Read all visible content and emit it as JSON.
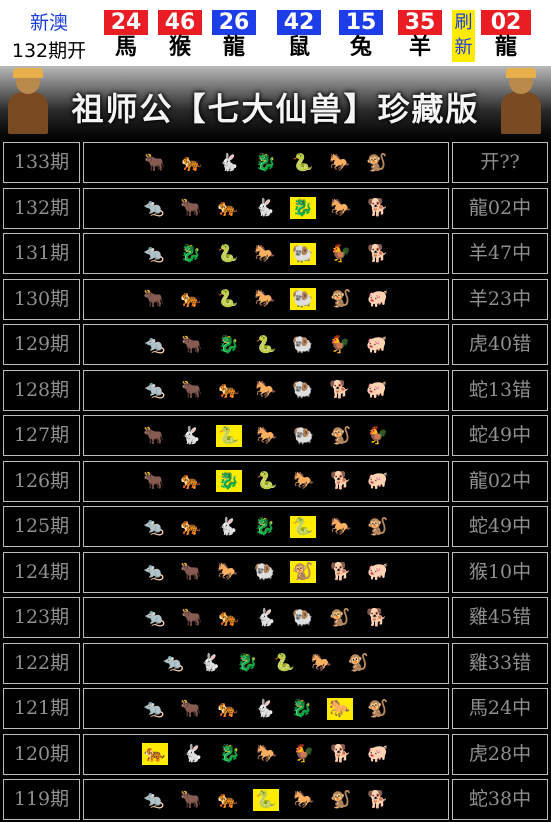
{
  "header": {
    "label_top": "新澳",
    "label_period": "132期开",
    "balls": [
      {
        "num": "24",
        "zodiac": "馬",
        "color": "red"
      },
      {
        "num": "46",
        "zodiac": "猴",
        "color": "red"
      },
      {
        "num": "26",
        "zodiac": "龍",
        "color": "blue"
      },
      {
        "num": "42",
        "zodiac": "鼠",
        "color": "blue"
      },
      {
        "num": "15",
        "zodiac": "兔",
        "color": "blue"
      },
      {
        "num": "35",
        "zodiac": "羊",
        "color": "red"
      }
    ],
    "refresh_label": "刷新",
    "special": {
      "num": "02",
      "zodiac": "龍",
      "color": "red"
    }
  },
  "banner": {
    "title": "祖师公【七大仙兽】珍藏版"
  },
  "icon_map": {
    "rat": "🐀",
    "ox": "🐂",
    "tiger": "🐅",
    "rabbit": "🐇",
    "dragon": "🐉",
    "snake": "🐍",
    "horse": "🐎",
    "goat": "🐏",
    "monkey": "🐒",
    "rooster": "🐓",
    "dog": "🐕",
    "pig": "🐖"
  },
  "rows": [
    {
      "period": "133期",
      "result": "开??",
      "animals": [
        "ox",
        "tiger",
        "rabbit",
        "dragon",
        "snake",
        "horse",
        "monkey"
      ],
      "highlight": -1
    },
    {
      "period": "132期",
      "result": "龍02中",
      "animals": [
        "rat",
        "ox",
        "tiger",
        "rabbit",
        "dragon",
        "horse",
        "dog"
      ],
      "highlight": 4
    },
    {
      "period": "131期",
      "result": "羊47中",
      "animals": [
        "rat",
        "dragon",
        "snake",
        "horse",
        "goat",
        "rooster",
        "dog"
      ],
      "highlight": 4
    },
    {
      "period": "130期",
      "result": "羊23中",
      "animals": [
        "ox",
        "tiger",
        "snake",
        "horse",
        "goat",
        "monkey",
        "pig"
      ],
      "highlight": 4
    },
    {
      "period": "129期",
      "result": "虎40错",
      "animals": [
        "rat",
        "ox",
        "dragon",
        "snake",
        "goat",
        "rooster",
        "pig"
      ],
      "highlight": -1
    },
    {
      "period": "128期",
      "result": "蛇13错",
      "animals": [
        "rat",
        "ox",
        "tiger",
        "horse",
        "goat",
        "dog",
        "pig"
      ],
      "highlight": -1
    },
    {
      "period": "127期",
      "result": "蛇49中",
      "animals": [
        "ox",
        "rabbit",
        "snake",
        "horse",
        "goat",
        "monkey",
        "rooster"
      ],
      "highlight": 2
    },
    {
      "period": "126期",
      "result": "龍02中",
      "animals": [
        "ox",
        "tiger",
        "dragon",
        "snake",
        "horse",
        "dog",
        "pig"
      ],
      "highlight": 2
    },
    {
      "period": "125期",
      "result": "蛇49中",
      "animals": [
        "rat",
        "tiger",
        "rabbit",
        "dragon",
        "snake",
        "horse",
        "monkey"
      ],
      "highlight": 4
    },
    {
      "period": "124期",
      "result": "猴10中",
      "animals": [
        "rat",
        "ox",
        "horse",
        "goat",
        "monkey",
        "dog",
        "pig"
      ],
      "highlight": 4
    },
    {
      "period": "123期",
      "result": "雞45错",
      "animals": [
        "rat",
        "ox",
        "tiger",
        "rabbit",
        "goat",
        "monkey",
        "dog"
      ],
      "highlight": -1
    },
    {
      "period": "122期",
      "result": "雞33错",
      "animals": [
        "rat",
        "rabbit",
        "dragon",
        "snake",
        "horse",
        "monkey"
      ],
      "highlight": -1
    },
    {
      "period": "121期",
      "result": "馬24中",
      "animals": [
        "rat",
        "ox",
        "tiger",
        "rabbit",
        "dragon",
        "horse",
        "monkey"
      ],
      "highlight": 5
    },
    {
      "period": "120期",
      "result": "虎28中",
      "animals": [
        "tiger",
        "rabbit",
        "dragon",
        "horse",
        "rooster",
        "dog",
        "pig"
      ],
      "highlight": 0
    },
    {
      "period": "119期",
      "result": "蛇38中",
      "animals": [
        "rat",
        "ox",
        "tiger",
        "snake",
        "horse",
        "monkey",
        "dog"
      ],
      "highlight": 3
    }
  ]
}
